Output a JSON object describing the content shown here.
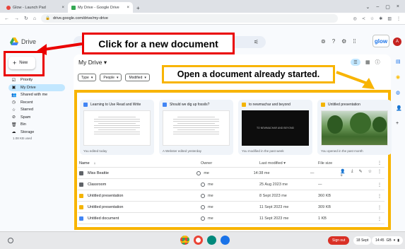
{
  "browser": {
    "tabs": [
      {
        "label": "Glow - Launch Pad",
        "active": false
      },
      {
        "label": "My Drive - Google Drive",
        "active": true
      }
    ],
    "new_tab": "+",
    "url": "drive.google.com/drive/my-drive"
  },
  "drive": {
    "logo_text": "Drive",
    "new_label": "New",
    "sidebar": [
      {
        "icon": "priority-icon",
        "glyph": "☑",
        "label": "Priority"
      },
      {
        "icon": "my-drive-icon",
        "glyph": "▣",
        "label": "My Drive",
        "active": true
      },
      {
        "icon": "shared-icon",
        "glyph": "👥",
        "label": "Shared with me"
      },
      {
        "icon": "recent-icon",
        "glyph": "◷",
        "label": "Recent"
      },
      {
        "icon": "star-icon",
        "glyph": "☆",
        "label": "Starred"
      },
      {
        "icon": "spam-icon",
        "glyph": "⊘",
        "label": "Spam"
      },
      {
        "icon": "bin-icon",
        "glyph": "🗑",
        "label": "Bin"
      },
      {
        "icon": "storage-icon",
        "glyph": "☁",
        "label": "Storage"
      }
    ],
    "storage_used": "1.08 KB used",
    "title": "My Drive",
    "filters": [
      "Type",
      "People",
      "Modified"
    ],
    "glow_label": "glow",
    "avatar_letter": "A",
    "cards": [
      {
        "type": "doc",
        "title": "Learning to Use Read and Write",
        "footer": "You edited today",
        "thumb": "doc"
      },
      {
        "type": "doc",
        "title": "Should we dig up fossils?",
        "footer": "A Webster edited yesterday",
        "thumb": "doc"
      },
      {
        "type": "slide",
        "title": "to newmachar and beyond",
        "footer": "You modified in the past week",
        "thumb": "dark",
        "thumb_text": "TO NEWMACHAR AND BEYOND"
      },
      {
        "type": "slide",
        "title": "Untitled presentation",
        "footer": "You opened in the past month",
        "thumb": "photo"
      }
    ],
    "columns": {
      "name": "Name",
      "owner": "Owner",
      "modified": "Last modified",
      "size": "File size"
    },
    "rows": [
      {
        "type": "folder",
        "name": "Miss Beattie",
        "owner": "me",
        "modified": "14:38 me",
        "size": "—"
      },
      {
        "type": "folder",
        "name": "Classroom",
        "owner": "me",
        "modified": "25 Aug 2023 me",
        "size": "—"
      },
      {
        "type": "slide",
        "name": "Untitled presentation",
        "owner": "me",
        "modified": "8 Sept 2023 me",
        "size": "360 KB"
      },
      {
        "type": "slide",
        "name": "Untitled presentation",
        "owner": "me",
        "modified": "11 Sept 2023 me",
        "size": "309 KB"
      },
      {
        "type": "doc",
        "name": "Untitled document",
        "owner": "me",
        "modified": "11 Sept 2023 me",
        "size": "1 KB"
      }
    ]
  },
  "annotations": {
    "new_callout": "Click for a new document",
    "open_callout": "Open a document already started."
  },
  "shelf": {
    "sign_out": "Sign out",
    "date": "18 Sept",
    "time": "14:45",
    "battery": "GB"
  },
  "colors": {
    "annotation_red": "#ea0000",
    "annotation_yellow": "#f8b400",
    "drive_blue": "#1a73e8"
  }
}
